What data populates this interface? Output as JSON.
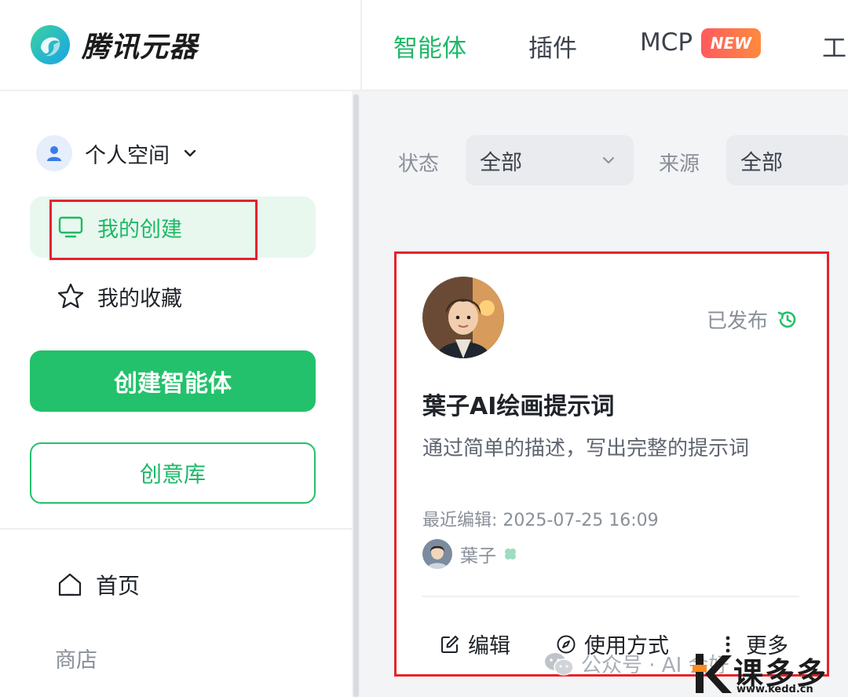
{
  "brand": {
    "name": "腾讯元器"
  },
  "sidebar": {
    "space_label": "个人空间",
    "nav": [
      {
        "label": "我的创建",
        "icon": "monitor-icon",
        "active": true
      },
      {
        "label": "我的收藏",
        "icon": "star-icon",
        "active": false
      }
    ],
    "create_button": "创建智能体",
    "library_button": "创意库",
    "home_label": "首页",
    "shop_label": "商店"
  },
  "top_nav": {
    "tabs": [
      {
        "label": "智能体",
        "active": true
      },
      {
        "label": "插件",
        "active": false
      },
      {
        "label": "MCP",
        "active": false
      },
      {
        "label": "工",
        "active": false
      }
    ],
    "new_badge": "NEW"
  },
  "filters": {
    "status_label": "状态",
    "status_value": "全部",
    "source_label": "来源",
    "source_value": "全部"
  },
  "agent_card": {
    "status": "已发布",
    "title": "葉子AI绘画提示词",
    "description": "通过简单的描述，写出完整的提示词",
    "last_edited": "最近编辑: 2025-07-25 16:09",
    "author": "葉子",
    "actions": {
      "edit": "编辑",
      "usage": "使用方式",
      "more": "更多"
    }
  },
  "watermark": {
    "text": "公众号 · AI 会好",
    "logo_text": "课多多",
    "logo_url": "www.kedd.cn"
  },
  "colors": {
    "accent": "#23c16b",
    "accent_text": "#1fb868",
    "highlight_box": "#e5232b",
    "badge_gradient_start": "#ff5a5f",
    "badge_gradient_end": "#ff8a3d"
  }
}
